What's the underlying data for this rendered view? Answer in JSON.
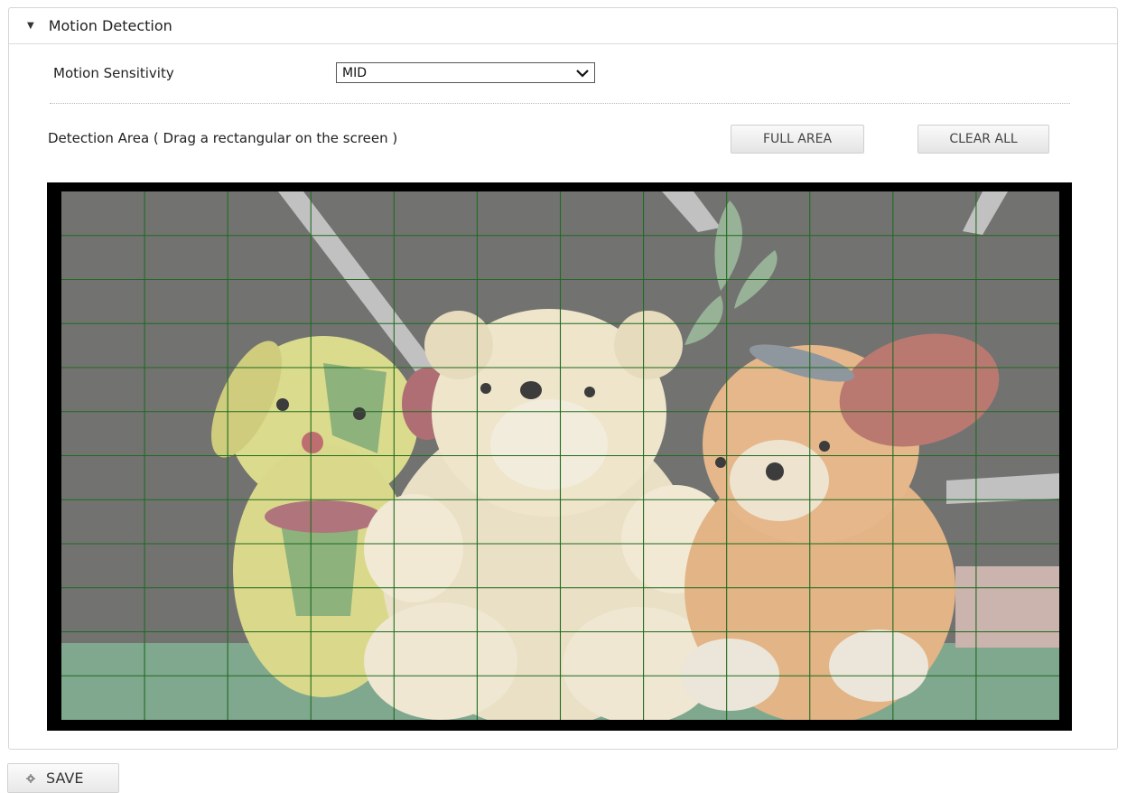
{
  "panel": {
    "title": "Motion Detection",
    "toggle_icon": "caret-down-icon"
  },
  "sensitivity": {
    "label": "Motion Sensitivity",
    "value": "MID",
    "icon": "chevron-down-icon"
  },
  "detection_area": {
    "label": "Detection Area ( Drag a rectangular on the screen )",
    "full_area_label": "FULL AREA",
    "clear_all_label": "CLEAR ALL"
  },
  "grid": {
    "columns": 12,
    "rows": 12,
    "line_color": "#1f6b1f"
  },
  "save": {
    "label": "SAVE",
    "icon": "gear-icon"
  }
}
